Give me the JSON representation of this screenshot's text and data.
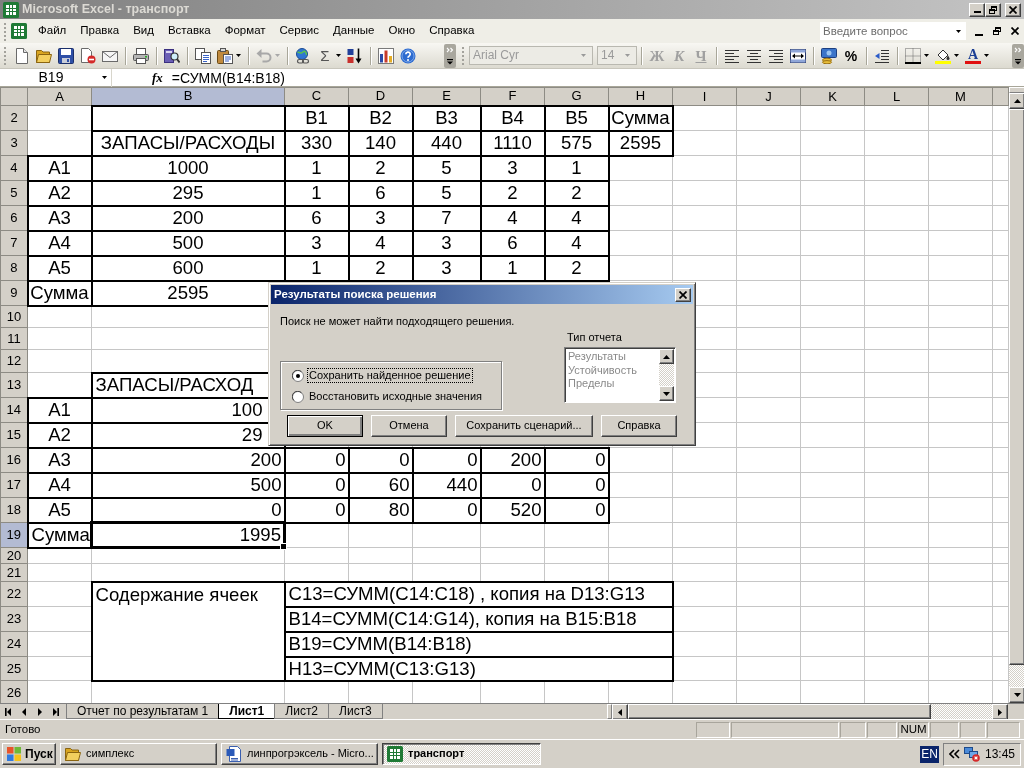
{
  "window": {
    "title": "Microsoft Excel - транспорт",
    "active": false
  },
  "menu": [
    "Файл",
    "Правка",
    "Вид",
    "Вставка",
    "Формат",
    "Сервис",
    "Данные",
    "Окно",
    "Справка"
  ],
  "help_box": {
    "placeholder": "Введите вопрос"
  },
  "standard_toolbar": {
    "autosum": "Σ",
    "undo": {
      "disabled": true
    }
  },
  "formatting_toolbar": {
    "font_name": "Arial Cyr",
    "font_size": "14",
    "font_controls_disabled": true,
    "bold": "Ж",
    "italic": "К",
    "underline": "Ч",
    "percent": "%",
    "font_color": "A"
  },
  "formula_bar": {
    "name_box": "B19",
    "function_button": "fx",
    "formula": "=СУММ(B14:B18)"
  },
  "sheet": {
    "columns": [
      {
        "label": "A",
        "selected": false
      },
      {
        "label": "B",
        "selected": true
      },
      {
        "label": "C",
        "selected": false
      },
      {
        "label": "D",
        "selected": false
      },
      {
        "label": "E",
        "selected": false
      },
      {
        "label": "F",
        "selected": false
      },
      {
        "label": "G",
        "selected": false
      },
      {
        "label": "H",
        "selected": false
      },
      {
        "label": "I",
        "selected": false
      },
      {
        "label": "J",
        "selected": false
      },
      {
        "label": "K",
        "selected": false
      },
      {
        "label": "L",
        "selected": false
      },
      {
        "label": "M",
        "selected": false
      }
    ],
    "rows": [
      {
        "label": "2",
        "selected": false,
        "kind": "cells",
        "cells": [
          null,
          {
            "boxed": true
          },
          {
            "text": "B1",
            "kind": "center",
            "boxed": true
          },
          {
            "text": "B2",
            "kind": "center",
            "boxed": true
          },
          {
            "text": "B3",
            "kind": "center",
            "boxed": true
          },
          {
            "text": "B4",
            "kind": "center",
            "boxed": true
          },
          {
            "text": "B5",
            "kind": "center",
            "boxed": true
          },
          {
            "text": "Сумма",
            "kind": "center",
            "boxed": true
          }
        ]
      },
      {
        "label": "3",
        "selected": false,
        "kind": "cells",
        "cells": [
          null,
          {
            "text": "ЗАПАСЫ/РАСХОДЫ",
            "kind": "center",
            "boxed": true
          },
          {
            "text": "330",
            "kind": "center",
            "boxed": true
          },
          {
            "text": "140",
            "kind": "center",
            "boxed": true
          },
          {
            "text": "440",
            "kind": "center",
            "boxed": true
          },
          {
            "text": "1110",
            "kind": "center",
            "boxed": true
          },
          {
            "text": "575",
            "kind": "center",
            "boxed": true
          },
          {
            "text": "2595",
            "kind": "center",
            "boxed": true
          }
        ]
      },
      {
        "label": "4",
        "selected": false,
        "kind": "cells",
        "cells": [
          {
            "text": "A1",
            "kind": "center",
            "boxed": true
          },
          {
            "text": "1000",
            "kind": "center",
            "boxed": true
          },
          {
            "text": "1",
            "kind": "center",
            "boxed": true
          },
          {
            "text": "2",
            "kind": "center",
            "boxed": true
          },
          {
            "text": "5",
            "kind": "center",
            "boxed": true
          },
          {
            "text": "3",
            "kind": "center",
            "boxed": true
          },
          {
            "text": "1",
            "kind": "center",
            "boxed": true
          }
        ]
      },
      {
        "label": "5",
        "selected": false,
        "kind": "cells",
        "cells": [
          {
            "text": "A2",
            "kind": "center",
            "boxed": true
          },
          {
            "text": "295",
            "kind": "center",
            "boxed": true
          },
          {
            "text": "1",
            "kind": "center",
            "boxed": true
          },
          {
            "text": "6",
            "kind": "center",
            "boxed": true
          },
          {
            "text": "5",
            "kind": "center",
            "boxed": true
          },
          {
            "text": "2",
            "kind": "center",
            "boxed": true
          },
          {
            "text": "2",
            "kind": "center",
            "boxed": true
          }
        ]
      },
      {
        "label": "6",
        "selected": false,
        "kind": "cells",
        "cells": [
          {
            "text": "A3",
            "kind": "center",
            "boxed": true
          },
          {
            "text": "200",
            "kind": "center",
            "boxed": true
          },
          {
            "text": "6",
            "kind": "center",
            "boxed": true
          },
          {
            "text": "3",
            "kind": "center",
            "boxed": true
          },
          {
            "text": "7",
            "kind": "center",
            "boxed": true
          },
          {
            "text": "4",
            "kind": "center",
            "boxed": true
          },
          {
            "text": "4",
            "kind": "center",
            "boxed": true
          }
        ]
      },
      {
        "label": "7",
        "selected": false,
        "kind": "cells",
        "cells": [
          {
            "text": "A4",
            "kind": "center",
            "boxed": true
          },
          {
            "text": "500",
            "kind": "center",
            "boxed": true
          },
          {
            "text": "3",
            "kind": "center",
            "boxed": true
          },
          {
            "text": "4",
            "kind": "center",
            "boxed": true
          },
          {
            "text": "3",
            "kind": "center",
            "boxed": true
          },
          {
            "text": "6",
            "kind": "center",
            "boxed": true
          },
          {
            "text": "4",
            "kind": "center",
            "boxed": true
          }
        ]
      },
      {
        "label": "8",
        "selected": false,
        "kind": "cells",
        "cells": [
          {
            "text": "A5",
            "kind": "center",
            "boxed": true
          },
          {
            "text": "600",
            "kind": "center",
            "boxed": true
          },
          {
            "text": "1",
            "kind": "center",
            "boxed": true
          },
          {
            "text": "2",
            "kind": "center",
            "boxed": true
          },
          {
            "text": "3",
            "kind": "center",
            "boxed": true
          },
          {
            "text": "1",
            "kind": "center",
            "boxed": true
          },
          {
            "text": "2",
            "kind": "center",
            "boxed": true
          }
        ]
      },
      {
        "label": "9",
        "selected": false,
        "kind": "cells",
        "cells": [
          {
            "text": "Сумма",
            "kind": "center",
            "boxed": true
          },
          {
            "text": "2595",
            "kind": "center",
            "boxed": true
          }
        ]
      },
      {
        "label": "10",
        "selected": false,
        "kind": "cells"
      },
      {
        "label": "11",
        "selected": false,
        "kind": "cells"
      },
      {
        "label": "12",
        "selected": false,
        "kind": "cells"
      },
      {
        "label": "13",
        "selected": false,
        "kind": "cells",
        "cells": [
          null,
          {
            "text": "ЗАПАСЫ/РАСХОД",
            "kind": "text",
            "boxed": true
          }
        ]
      },
      {
        "label": "14",
        "selected": false,
        "kind": "cells",
        "cells": [
          {
            "text": "A1",
            "kind": "center",
            "boxed": true
          },
          {
            "text": "100",
            "kind": "number",
            "boxed": true
          }
        ]
      },
      {
        "label": "15",
        "selected": false,
        "kind": "cells",
        "cells": [
          {
            "text": "A2",
            "kind": "center",
            "boxed": true
          },
          {
            "text": "29",
            "kind": "number",
            "boxed": true
          }
        ]
      },
      {
        "label": "16",
        "selected": false,
        "kind": "cells",
        "cells": [
          {
            "text": "A3",
            "kind": "center",
            "boxed": true
          },
          {
            "text": "200",
            "kind": "number",
            "boxed": true
          },
          {
            "text": "0",
            "kind": "number",
            "boxed": true
          },
          {
            "text": "0",
            "kind": "number",
            "boxed": true
          },
          {
            "text": "0",
            "kind": "number",
            "boxed": true
          },
          {
            "text": "200",
            "kind": "number",
            "boxed": true
          },
          {
            "text": "0",
            "kind": "number",
            "boxed": true
          }
        ]
      },
      {
        "label": "17",
        "selected": false,
        "kind": "cells",
        "cells": [
          {
            "text": "A4",
            "kind": "center",
            "boxed": true
          },
          {
            "text": "500",
            "kind": "number",
            "boxed": true
          },
          {
            "text": "0",
            "kind": "number",
            "boxed": true
          },
          {
            "text": "60",
            "kind": "number",
            "boxed": true
          },
          {
            "text": "440",
            "kind": "number",
            "boxed": true
          },
          {
            "text": "0",
            "kind": "number",
            "boxed": true
          },
          {
            "text": "0",
            "kind": "number",
            "boxed": true
          }
        ]
      },
      {
        "label": "18",
        "selected": false,
        "kind": "cells",
        "cells": [
          {
            "text": "A5",
            "kind": "center",
            "boxed": true
          },
          {
            "text": "0",
            "kind": "number",
            "boxed": true
          },
          {
            "text": "0",
            "kind": "number",
            "boxed": true
          },
          {
            "text": "80",
            "kind": "number",
            "boxed": true
          },
          {
            "text": "0",
            "kind": "number",
            "boxed": true
          },
          {
            "text": "520",
            "kind": "number",
            "boxed": true
          },
          {
            "text": "0",
            "kind": "number",
            "boxed": true
          }
        ]
      },
      {
        "label": "19",
        "selected": true,
        "kind": "cells",
        "cells": [
          {
            "text": "Сумма",
            "kind": "text",
            "boxed": true
          },
          {
            "text": "1995",
            "kind": "number",
            "boxed": true
          }
        ]
      },
      {
        "label": "20",
        "selected": false,
        "kind": "cells"
      },
      {
        "label": "21",
        "selected": false,
        "kind": "cells"
      },
      {
        "label": "22",
        "selected": false,
        "kind": "note",
        "heading": "Содержание ячеек",
        "text": "C13=СУММ(C14:C18) , копия на D13:G13"
      },
      {
        "label": "23",
        "selected": false,
        "kind": "note",
        "text": "B14=СУММ(C14:G14), копия на B15:B18"
      },
      {
        "label": "24",
        "selected": false,
        "kind": "note",
        "text": "B19=СУММ(B14:B18)"
      },
      {
        "label": "25",
        "selected": false,
        "kind": "note",
        "text": "H13=СУММ(C13:G13)"
      },
      {
        "label": "26",
        "selected": false,
        "kind": "cells"
      }
    ]
  },
  "dialog": {
    "title": "Результаты поиска решения",
    "message": "Поиск не может найти подходящего решения.",
    "options": [
      {
        "label": "Сохранить найденное решение",
        "selected": true,
        "focused": true
      },
      {
        "label": "Восстановить исходные значения",
        "selected": false,
        "focused": false
      }
    ],
    "report_type": {
      "label": "Тип отчета",
      "disabled": true,
      "items": [
        "Результаты",
        "Устойчивость",
        "Пределы"
      ]
    },
    "buttons": [
      {
        "label": "OK",
        "default": true
      },
      {
        "label": "Отмена",
        "default": false
      },
      {
        "label": "Сохранить сценарий...",
        "default": false
      },
      {
        "label": "Справка",
        "default": false
      }
    ]
  },
  "sheet_tabs": [
    {
      "label": "Отчет по результатам 1",
      "selected": false
    },
    {
      "label": "Лист1",
      "selected": true
    },
    {
      "label": "Лист2",
      "selected": false
    },
    {
      "label": "Лист3",
      "selected": false
    }
  ],
  "status_bar": {
    "text": "Готово",
    "indicator": "NUM"
  },
  "taskbar": {
    "start": "Пуск",
    "tasks": [
      {
        "label": "симплекс",
        "kind": "folder",
        "selected": false
      },
      {
        "label": "линпрогрэксель - Micro...",
        "kind": "document",
        "selected": false
      },
      {
        "label": "транспорт",
        "kind": "spreadsheet",
        "selected": true
      }
    ],
    "language": "EN",
    "clock": "13:45"
  }
}
